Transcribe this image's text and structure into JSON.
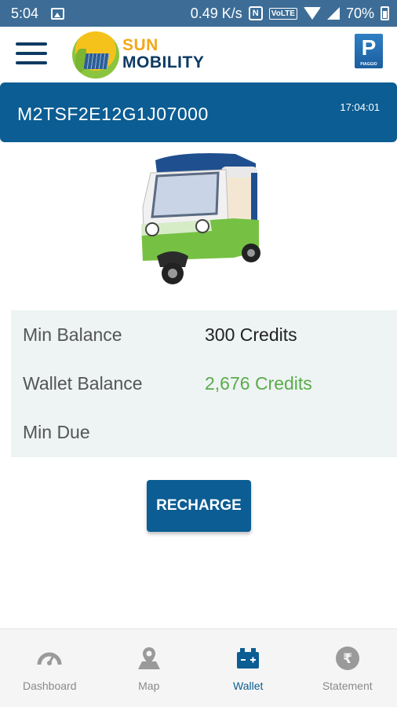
{
  "status_bar": {
    "time": "5:04",
    "network_speed": "0.49 K/s",
    "nfc": "N",
    "volte": "VoLTE",
    "battery": "70%",
    "icons": [
      "gallery-icon",
      "nfc-icon",
      "volte-icon",
      "wifi-icon",
      "signal-icon",
      "battery-icon"
    ]
  },
  "header": {
    "menu_icon": "hamburger-menu-icon",
    "brand_line1": "SUN",
    "brand_line2": "MOBILITY",
    "partner_letter": "P",
    "partner_caption": "PIAGGIO"
  },
  "vehicle": {
    "id": "M2TSF2E12G1J07000",
    "time": "17:04:01",
    "image": "electric-auto-rickshaw"
  },
  "balances": [
    {
      "label": "Min Balance",
      "value": "300 Credits"
    },
    {
      "label": "Wallet Balance",
      "value": "2,676 Credits"
    },
    {
      "label": "Min Due",
      "value": ""
    }
  ],
  "actions": {
    "recharge_label": "RECHARGE"
  },
  "bottom_nav": {
    "items": [
      {
        "label": "Dashboard",
        "icon": "speedometer-icon",
        "active": false
      },
      {
        "label": "Map",
        "icon": "map-pin-icon",
        "active": false
      },
      {
        "label": "Wallet",
        "icon": "wallet-icon",
        "active": true
      },
      {
        "label": "Statement",
        "icon": "rupee-icon",
        "active": false
      }
    ]
  },
  "colors": {
    "status_bar": "#3d6d96",
    "primary": "#0b5d93",
    "brand_orange": "#f2a81c",
    "brand_navy": "#0c3a63",
    "positive_green": "#5aac4a",
    "card_background": "#eef3f3"
  }
}
